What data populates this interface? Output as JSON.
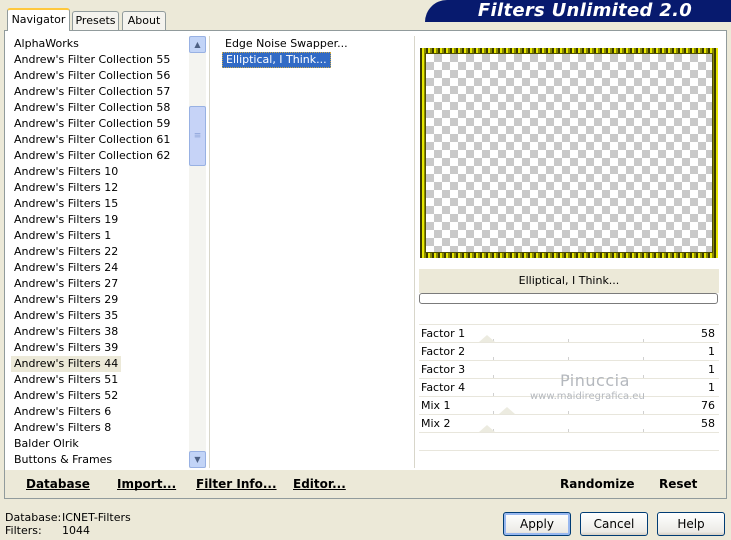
{
  "banner": {
    "title": "Filters Unlimited 2.0"
  },
  "tabs": [
    {
      "label": "Navigator",
      "active": true
    },
    {
      "label": "Presets",
      "active": false
    },
    {
      "label": "About",
      "active": false
    }
  ],
  "categories": [
    "AlphaWorks",
    "Andrew's Filter Collection 55",
    "Andrew's Filter Collection 56",
    "Andrew's Filter Collection 57",
    "Andrew's Filter Collection 58",
    "Andrew's Filter Collection 59",
    "Andrew's Filter Collection 61",
    "Andrew's Filter Collection 62",
    "Andrew's Filters 10",
    "Andrew's Filters 12",
    "Andrew's Filters 15",
    "Andrew's Filters 19",
    "Andrew's Filters 1",
    "Andrew's Filters 22",
    "Andrew's Filters 24",
    "Andrew's Filters 27",
    "Andrew's Filters 29",
    "Andrew's Filters 35",
    "Andrew's Filters 38",
    "Andrew's Filters 39",
    "Andrew's Filters 44",
    "Andrew's Filters 51",
    "Andrew's Filters 52",
    "Andrew's Filters 6",
    "Andrew's Filters 8",
    "Balder Olrik",
    "Buttons & Frames"
  ],
  "selected_category": "Andrew's Filters 44",
  "filters": [
    "Edge Noise Swapper...",
    "Elliptical, I Think..."
  ],
  "selected_filter": "Elliptical, I Think...",
  "preview": {
    "filter_name": "Elliptical, I Think...",
    "progress": 0
  },
  "parameters": [
    {
      "name": "Factor 1",
      "value": "58"
    },
    {
      "name": "Factor 2",
      "value": "1"
    },
    {
      "name": "Factor 3",
      "value": "1"
    },
    {
      "name": "Factor 4",
      "value": "1"
    },
    {
      "name": "Mix 1",
      "value": "76"
    },
    {
      "name": "Mix 2",
      "value": "58"
    }
  ],
  "watermark": {
    "line1": "Pinuccia",
    "line2": "www.maidiregrafica.eu"
  },
  "toolbar": {
    "database": "Database",
    "import": "Import...",
    "filter_info": "Filter Info...",
    "editor": "Editor...",
    "randomize": "Randomize",
    "reset": "Reset"
  },
  "status": {
    "database_label": "Database:",
    "database_value": "ICNET-Filters",
    "filters_label": "Filters:",
    "filters_value": "1044"
  },
  "buttons": {
    "apply": "Apply",
    "cancel": "Cancel",
    "help": "Help"
  },
  "colors": {
    "banner": "#071a6e",
    "selection": "#316ac5"
  }
}
